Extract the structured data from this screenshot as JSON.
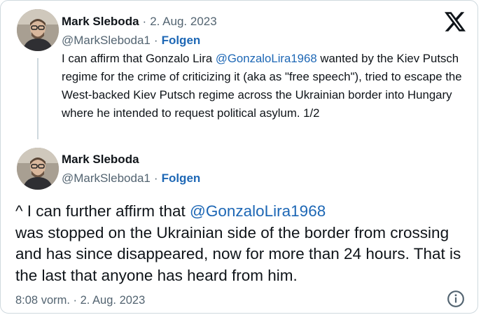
{
  "tweet1": {
    "author_name": "Mark Sleboda",
    "separator": "·",
    "date": "2. Aug. 2023",
    "handle": "@MarkSleboda1",
    "follow_label": "Folgen",
    "text_part1": "I can affirm that Gonzalo Lira ",
    "mention": "@GonzaloLira1968",
    "text_part2": " wanted by the Kiev Putsch regime for the crime of criticizing it (aka as \"free speech\"), tried to escape  the West-backed Kiev Putsch regime across the Ukrainian border into Hungary where he intended to request political asylum. 1/2"
  },
  "tweet2": {
    "author_name": "Mark Sleboda",
    "handle": "@MarkSleboda1",
    "separator": "·",
    "follow_label": "Folgen",
    "text_part1": "^ I can further affirm that ",
    "mention": "@GonzaloLira1968",
    "text_part2": "was stopped on the Ukrainian side of the border from crossing and has since disappeared, now for more than 24 hours. That is the last that anyone has heard from him.",
    "timestamp": "8:08 vorm. · 2. Aug. 2023"
  },
  "icons": {
    "platform_logo": "x-logo-icon",
    "info": "info-icon",
    "avatar": "avatar"
  },
  "colors": {
    "link": "#1d67b5",
    "muted": "#536471",
    "text": "#0f1419",
    "border": "#cfd9de"
  }
}
